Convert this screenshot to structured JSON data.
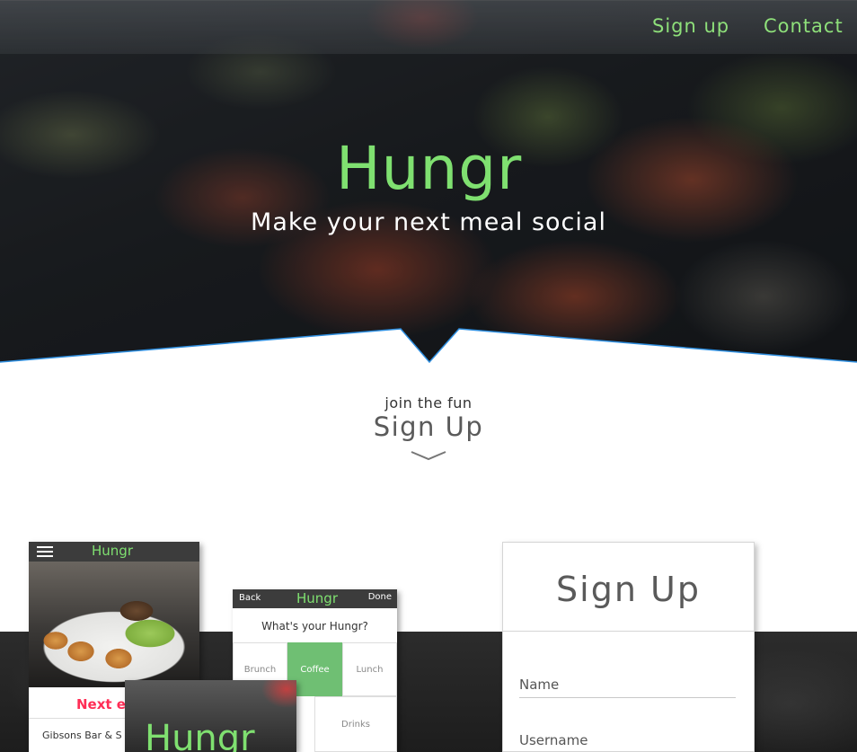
{
  "nav": {
    "signup": "Sign up",
    "contact": "Contact"
  },
  "hero": {
    "logo": "Hungr",
    "tagline": "Make your next meal social"
  },
  "signup_section": {
    "kicker": "join the fun",
    "heading": "Sign Up"
  },
  "mockup_events": {
    "logo": "Hungr",
    "next_event": "Next ev",
    "venue": "Gibsons Bar & S"
  },
  "mockup_choose": {
    "back": "Back",
    "logo": "Hungr",
    "done": "Done",
    "question": "What's your Hungr?",
    "options": [
      "Brunch",
      "Coffee",
      "Lunch",
      "Drinks"
    ],
    "selected": "Coffee"
  },
  "mockup_splash": {
    "logo": "Hungr"
  },
  "form": {
    "title": "Sign Up",
    "name_placeholder": "Name",
    "username_placeholder": "Username"
  },
  "colors": {
    "accent": "#7fe070",
    "selected": "#6fbf73",
    "alert": "#ff2d55",
    "divider_line": "#1e90ff"
  }
}
